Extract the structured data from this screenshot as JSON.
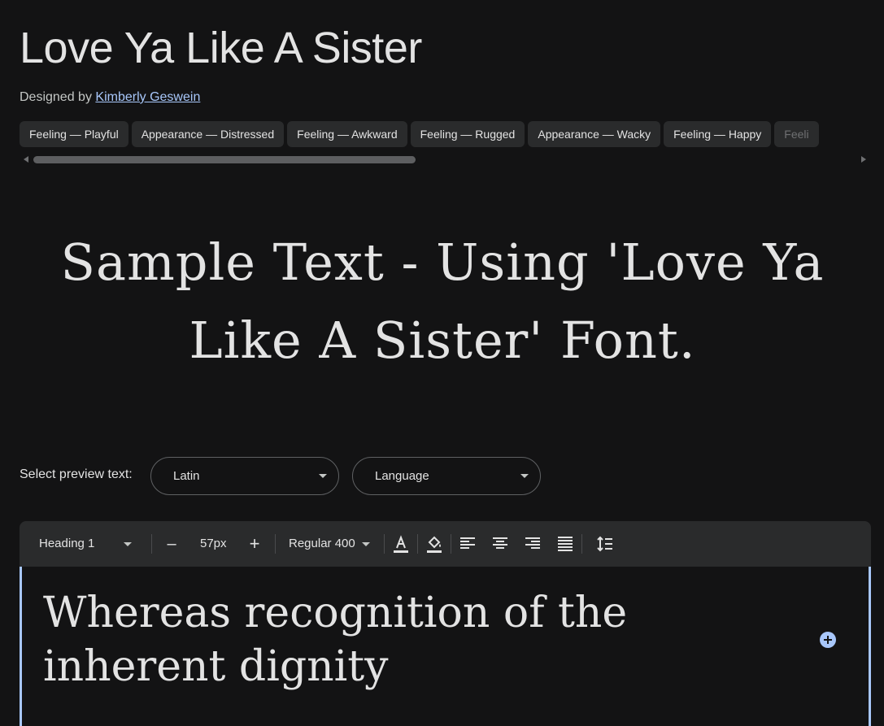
{
  "font": {
    "title": "Love Ya Like A Sister",
    "designed_by_label": "Designed by",
    "designer_name": "Kimberly Geswein"
  },
  "tags": [
    "Feeling — Playful",
    "Appearance — Distressed",
    "Feeling — Awkward",
    "Feeling — Rugged",
    "Appearance — Wacky",
    "Feeling — Happy",
    "Feeli"
  ],
  "sample": {
    "line1": "Sample Text - Using 'Love Ya",
    "line2": "Like A Sister' Font."
  },
  "preview": {
    "label": "Select preview text:",
    "script_value": "Latin",
    "language_value": "Language"
  },
  "toolbar": {
    "style_value": "Heading 1",
    "decrease_label": "–",
    "size_value": "57px",
    "increase_label": "+",
    "weight_value": "Regular 400",
    "text_color": "#e3e3e3",
    "highlight_color": "#e3e3e3"
  },
  "editor": {
    "line1": "Whereas recognition of the",
    "line2": "inherent dignity"
  },
  "colors": {
    "background": "#131314",
    "accent": "#a8c7fa",
    "surface": "#2a2b2c"
  }
}
